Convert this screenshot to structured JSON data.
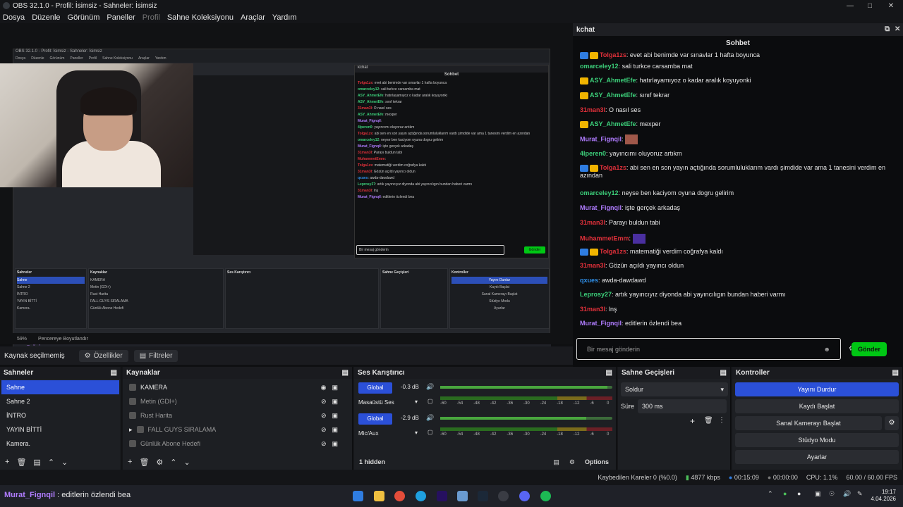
{
  "window": {
    "title": "OBS 32.1.0 - Profil: İsimsiz - Sahneler: İsimsiz"
  },
  "menu": [
    "Dosya",
    "Düzenle",
    "Görünüm",
    "Paneller",
    "Profil",
    "Sahne Koleksiyonu",
    "Araçlar",
    "Yardım"
  ],
  "preview": {
    "mini_title": "OBS 32.1.0 - Profil: İsimsiz - Sahneler: İsimsiz",
    "mini_menu": [
      "Dosya",
      "Düzenle",
      "Görünüm",
      "Paneller",
      "Profil",
      "Sahne Koleksiyonu",
      "Araçlar",
      "Yardım"
    ],
    "mini_chat_title": "kchat",
    "mini_chat_header": "Sohbet",
    "mini_input_placeholder": "Bir mesaj gönderin",
    "mini_send": "Gönder",
    "mini_lower_third": "Murat_Fignqil : editlerin özlendi bea",
    "zoom": "59%",
    "window_size": "Pencereye Boyutlandır"
  },
  "source_bar": {
    "label": "Kaynak seçilmemiş",
    "properties": "Özellikler",
    "filters": "Filtreler"
  },
  "chat": {
    "window_title": "kchat",
    "header": "Sohbet",
    "messages": [
      {
        "user": "Tolga1zs",
        "color": "#e0303a",
        "text": "evet abi benimde var sınavlar 1 hafta boyunca",
        "badges": [
          "blue",
          "gold"
        ]
      },
      {
        "user": "omarceley12",
        "color": "#3ccf7a",
        "text": "sali turkce carsamba mat",
        "badges": []
      },
      {
        "user": "ASY_AhmetEfe",
        "color": "#3ccf7a",
        "text": "hatırlayamıyoz o kadar aralık koyuyonki",
        "badges": [
          "gold"
        ]
      },
      {
        "user": "ASY_AhmetEfe",
        "color": "#3ccf7a",
        "text": "sınıf tekrar",
        "badges": [
          "gold"
        ]
      },
      {
        "user": "31man3l",
        "color": "#e0303a",
        "text": "O nasıl ses",
        "badges": []
      },
      {
        "user": "ASY_AhmetEfe",
        "color": "#3ccf7a",
        "text": "mexper",
        "badges": [
          "gold"
        ]
      },
      {
        "user": "Murat_Fignqil",
        "color": "#b07cff",
        "text": "",
        "badges": [],
        "emote": "#a0584a"
      },
      {
        "user": "4lperen0",
        "color": "#3ccf7a",
        "text": "yayıncımı oluyoruz artıkm",
        "badges": []
      },
      {
        "user": "Tolga1zs",
        "color": "#e0303a",
        "text": "abi sen en son yayın açtığında sorumluluklarım vardı şimdide var ama 1 tanesini verdim en azından",
        "badges": [
          "blue",
          "gold"
        ]
      },
      {
        "user": "omarceley12",
        "color": "#3ccf7a",
        "text": "neyse ben kaciyom oyuna dogru gelirim",
        "badges": []
      },
      {
        "user": "Murat_Fignqil",
        "color": "#b07cff",
        "text": "işte gerçek arkadaş",
        "badges": []
      },
      {
        "user": "31man3l",
        "color": "#e0303a",
        "text": "Parayı buldun tabi",
        "badges": []
      },
      {
        "user": "MuhammetEmm",
        "color": "#e0303a",
        "text": "",
        "badges": [],
        "emote": "#4a2fa0"
      },
      {
        "user": "Tolga1zs",
        "color": "#e0303a",
        "text": "matematiği verdim coğrafya kaldı",
        "badges": [
          "blue",
          "gold"
        ]
      },
      {
        "user": "31man3l",
        "color": "#e0303a",
        "text": "Gözün açıldı yayıncı oldun",
        "badges": []
      },
      {
        "user": "qxues",
        "color": "#2f8fe8",
        "text": "awda-dawdawd",
        "badges": []
      },
      {
        "user": "Leprosy27",
        "color": "#3ccf7a",
        "text": "artık yayıncıyız diyonda abi yayıncılıgın bundan haberi varmı",
        "badges": []
      },
      {
        "user": "31man3l",
        "color": "#e0303a",
        "text": "lnş",
        "badges": []
      },
      {
        "user": "Murat_Fignqil",
        "color": "#b07cff",
        "text": "editlerin özlendi bea",
        "badges": []
      }
    ],
    "input_placeholder": "Bir mesaj gönderin",
    "send": "Gönder"
  },
  "docks": {
    "scenes": {
      "title": "Sahneler",
      "items": [
        "Sahne",
        "Sahne 2",
        "İNTRO",
        "YAYIN BİTTİ",
        "Kamera."
      ],
      "selected": 0
    },
    "sources": {
      "title": "Kaynaklar",
      "items": [
        "KAMERA",
        "Metin (GDI+)",
        "Rust Harita",
        "FALL GUYS SIRALAMA",
        "Günlük Abone Hedefi"
      ]
    },
    "mixer": {
      "title": "Ses Karıştırıcı",
      "channels": [
        {
          "name": "Masaüstü Ses",
          "db": "-0.3 dB",
          "global": "Global",
          "level": 0.97
        },
        {
          "name": "Mic/Aux",
          "db": "-2.9 dB",
          "global": "Global",
          "level": 0.85
        }
      ],
      "ticks": [
        "-60",
        "-54",
        "-48",
        "-42",
        "-36",
        "-30",
        "-24",
        "-18",
        "-12",
        "-6",
        "0"
      ],
      "hidden": "1 hidden",
      "options": "Options"
    },
    "transitions": {
      "title": "Sahne Geçişleri",
      "selected": "Soldur",
      "duration_label": "Süre",
      "duration": "300 ms"
    },
    "controls": {
      "title": "Kontroller",
      "buttons": [
        "Yayını Durdur",
        "Kaydı Başlat",
        "Sanal Kamerayı Başlat",
        "Stüdyo Modu",
        "Ayarlar"
      ]
    }
  },
  "status": {
    "dropped": "Kaybedilen Kareler 0 (%0.0)",
    "bitrate": "4877 kbps",
    "stream_time": "00:15:09",
    "rec_time": "00:00:00",
    "cpu": "CPU: 1.1%",
    "fps": "60.00 / 60.00 FPS"
  },
  "taskbar": {
    "lower_user": "Murat_Fignqil",
    "lower_text": ": editlerin özlendi bea",
    "time": "19:17",
    "date": "4.04.2026"
  }
}
